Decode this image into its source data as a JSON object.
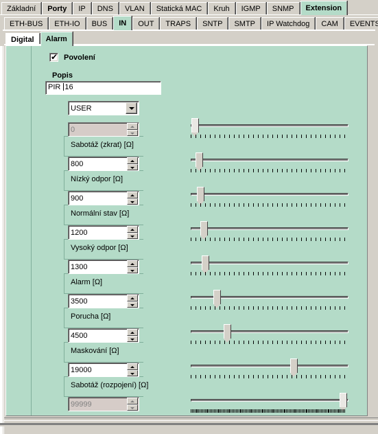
{
  "tabs_row1": [
    {
      "label": "Základní",
      "state": "normal"
    },
    {
      "label": "Porty",
      "state": "bold"
    },
    {
      "label": "IP",
      "state": "normal"
    },
    {
      "label": "DNS",
      "state": "normal"
    },
    {
      "label": "VLAN",
      "state": "normal"
    },
    {
      "label": "Statická MAC",
      "state": "normal"
    },
    {
      "label": "Kruh",
      "state": "normal"
    },
    {
      "label": "IGMP",
      "state": "normal"
    },
    {
      "label": "SNMP",
      "state": "normal"
    },
    {
      "label": "Extension",
      "state": "selected"
    }
  ],
  "tabs_row2": [
    {
      "label": "ETH-BUS",
      "state": "normal"
    },
    {
      "label": "ETH-IO",
      "state": "normal"
    },
    {
      "label": "BUS",
      "state": "normal"
    },
    {
      "label": "IN",
      "state": "selected"
    },
    {
      "label": "OUT",
      "state": "normal"
    },
    {
      "label": "TRAPS",
      "state": "normal"
    },
    {
      "label": "SNTP",
      "state": "normal"
    },
    {
      "label": "SMTP",
      "state": "normal"
    },
    {
      "label": "IP Watchdog",
      "state": "normal"
    },
    {
      "label": "CAM",
      "state": "normal"
    },
    {
      "label": "EVENTS",
      "state": "normal"
    }
  ],
  "tabs_row3": [
    {
      "label": "Digital",
      "state": "white"
    },
    {
      "label": "Alarm",
      "state": "selected"
    }
  ],
  "form": {
    "enable_checkbox": {
      "label": "Povolení",
      "checked": true,
      "mark": "✔"
    },
    "description": {
      "label": "Popis",
      "value_before_caret": "PIR ",
      "value_after_caret": "16",
      "full_value": "PIR 16"
    },
    "mode_combo": {
      "value": "USER"
    }
  },
  "thresholds": [
    {
      "value": "0",
      "label": "Sabotáž (zkrat) [Ω]",
      "disabled": true,
      "slider_pct": 0.5,
      "focus": true,
      "dense_ticks": false
    },
    {
      "value": "800",
      "label": "Nízký odpor [Ω]",
      "disabled": false,
      "slider_pct": 3.0,
      "focus": false,
      "dense_ticks": false
    },
    {
      "value": "900",
      "label": "Normální stav [Ω]",
      "disabled": false,
      "slider_pct": 4.0,
      "focus": false,
      "dense_ticks": false
    },
    {
      "value": "1200",
      "label": "Vysoký odpor [Ω]",
      "disabled": false,
      "slider_pct": 6.5,
      "focus": false,
      "dense_ticks": false
    },
    {
      "value": "1300",
      "label": "Alarm [Ω]",
      "disabled": false,
      "slider_pct": 7.5,
      "focus": false,
      "dense_ticks": false
    },
    {
      "value": "3500",
      "label": "Porucha [Ω]",
      "disabled": false,
      "slider_pct": 15.0,
      "focus": false,
      "dense_ticks": false
    },
    {
      "value": "4500",
      "label": "Maskování [Ω]",
      "disabled": false,
      "slider_pct": 22.0,
      "focus": false,
      "dense_ticks": false
    },
    {
      "value": "19000",
      "label": "Sabotáž (rozpojení) [Ω]",
      "disabled": false,
      "slider_pct": 66.0,
      "focus": false,
      "dense_ticks": false
    },
    {
      "value": "99999",
      "label": "",
      "disabled": true,
      "slider_pct": 99.0,
      "focus": true,
      "dense_ticks": true
    }
  ],
  "colors": {
    "panel_bg": "#b4dbc8",
    "window_bg": "#d4d0c8",
    "tab_selected_bg": "#b4dbc8",
    "field_bg": "#ffffff",
    "field_disabled_bg": "#d6ccc8",
    "text": "#000000",
    "disabled_text": "#808080"
  }
}
